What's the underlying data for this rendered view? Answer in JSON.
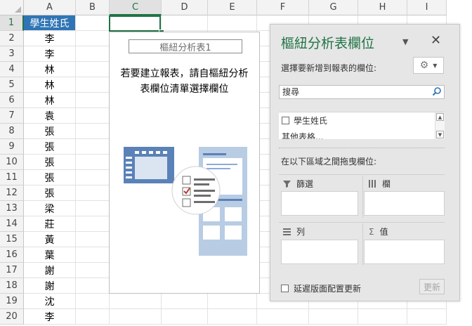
{
  "sheet": {
    "columns": [
      "A",
      "B",
      "C",
      "D",
      "E",
      "F",
      "G",
      "H",
      "I"
    ],
    "selected_column": "C",
    "rows": [
      "1",
      "2",
      "3",
      "4",
      "5",
      "6",
      "7",
      "8",
      "9",
      "10",
      "11",
      "12",
      "13",
      "14",
      "15",
      "16",
      "17",
      "18",
      "19",
      "20"
    ],
    "selected_row": "1",
    "column_a_values": [
      "學生姓氏",
      "李",
      "李",
      "林",
      "林",
      "林",
      "袁",
      "張",
      "張",
      "張",
      "張",
      "張",
      "梁",
      "莊",
      "黃",
      "葉",
      "謝",
      "謝",
      "沈",
      "李"
    ],
    "header_cell_color": "#2f75b5"
  },
  "pivot": {
    "title": "樞紐分析表1",
    "instruction_line1": "若要建立報表，請自樞紐分析",
    "instruction_line2": "表欄位清單選擇欄位"
  },
  "pane": {
    "title": "樞紐分析表欄位",
    "choose_label": "選擇要新增到報表的欄位:",
    "search_placeholder": "搜尋",
    "fields": [
      "學生姓氏",
      "其他表格..."
    ],
    "drag_label": "在以下區域之間拖曳欄位:",
    "areas": {
      "filters": "篩選",
      "columns": "欄",
      "rows": "列",
      "values": "值"
    },
    "defer_label": "延遲版面配置更新",
    "update_label": "更新",
    "accent_color": "#217346"
  }
}
